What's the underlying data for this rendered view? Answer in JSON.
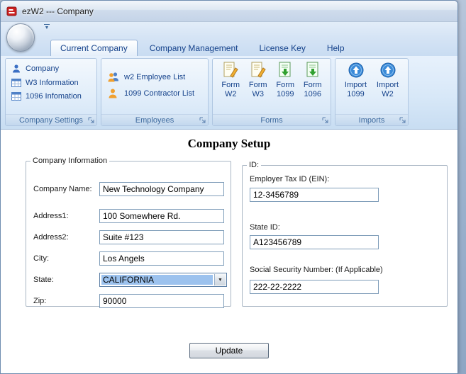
{
  "window": {
    "title": "ezW2 --- Company"
  },
  "colors": {
    "selection_highlight": "#9cc2ee",
    "ribbon_text": "#15428b",
    "caption_text": "#3e6a9e"
  },
  "ribbon": {
    "tabs": [
      {
        "label": "Current Company",
        "active": true
      },
      {
        "label": "Company Management",
        "active": false
      },
      {
        "label": "License Key",
        "active": false
      },
      {
        "label": "Help",
        "active": false
      }
    ],
    "groups": {
      "company_settings": {
        "caption": "Company Settings",
        "items": [
          {
            "label": "Company"
          },
          {
            "label": "W3 Information"
          },
          {
            "label": "1096 Infomation"
          }
        ]
      },
      "employees": {
        "caption": "Employees",
        "items": [
          {
            "label": "w2 Employee List"
          },
          {
            "label": "1099 Contractor List"
          }
        ]
      },
      "forms": {
        "caption": "Forms",
        "buttons": [
          {
            "top": "Form",
            "bottom": "W2"
          },
          {
            "top": "Form",
            "bottom": "W3"
          },
          {
            "top": "Form",
            "bottom": "1099"
          },
          {
            "top": "Form",
            "bottom": "1096"
          }
        ]
      },
      "imports": {
        "caption": "Imports",
        "buttons": [
          {
            "top": "Import",
            "bottom": "1099"
          },
          {
            "top": "Import",
            "bottom": "W2"
          }
        ]
      }
    }
  },
  "main": {
    "title": "Company Setup",
    "company_info": {
      "caption": "Company Information",
      "fields": [
        {
          "label": "Company Name:",
          "value": "New Technology Company"
        },
        {
          "label": "Address1:",
          "value": "100 Somewhere Rd."
        },
        {
          "label": "Address2:",
          "value": "Suite #123"
        },
        {
          "label": "City:",
          "value": "Los Angels"
        },
        {
          "label": "State:",
          "value": "CALIFORNIA"
        },
        {
          "label": "Zip:",
          "value": "90000"
        }
      ]
    },
    "id_info": {
      "caption": "ID:",
      "fields": [
        {
          "label": "Employer Tax ID (EIN):",
          "value": "12-3456789"
        },
        {
          "label": "State ID:",
          "value": "A123456789"
        },
        {
          "label": "Social Security Number: (If Applicable)",
          "value": "222-22-2222"
        }
      ]
    },
    "update_button": "Update"
  }
}
